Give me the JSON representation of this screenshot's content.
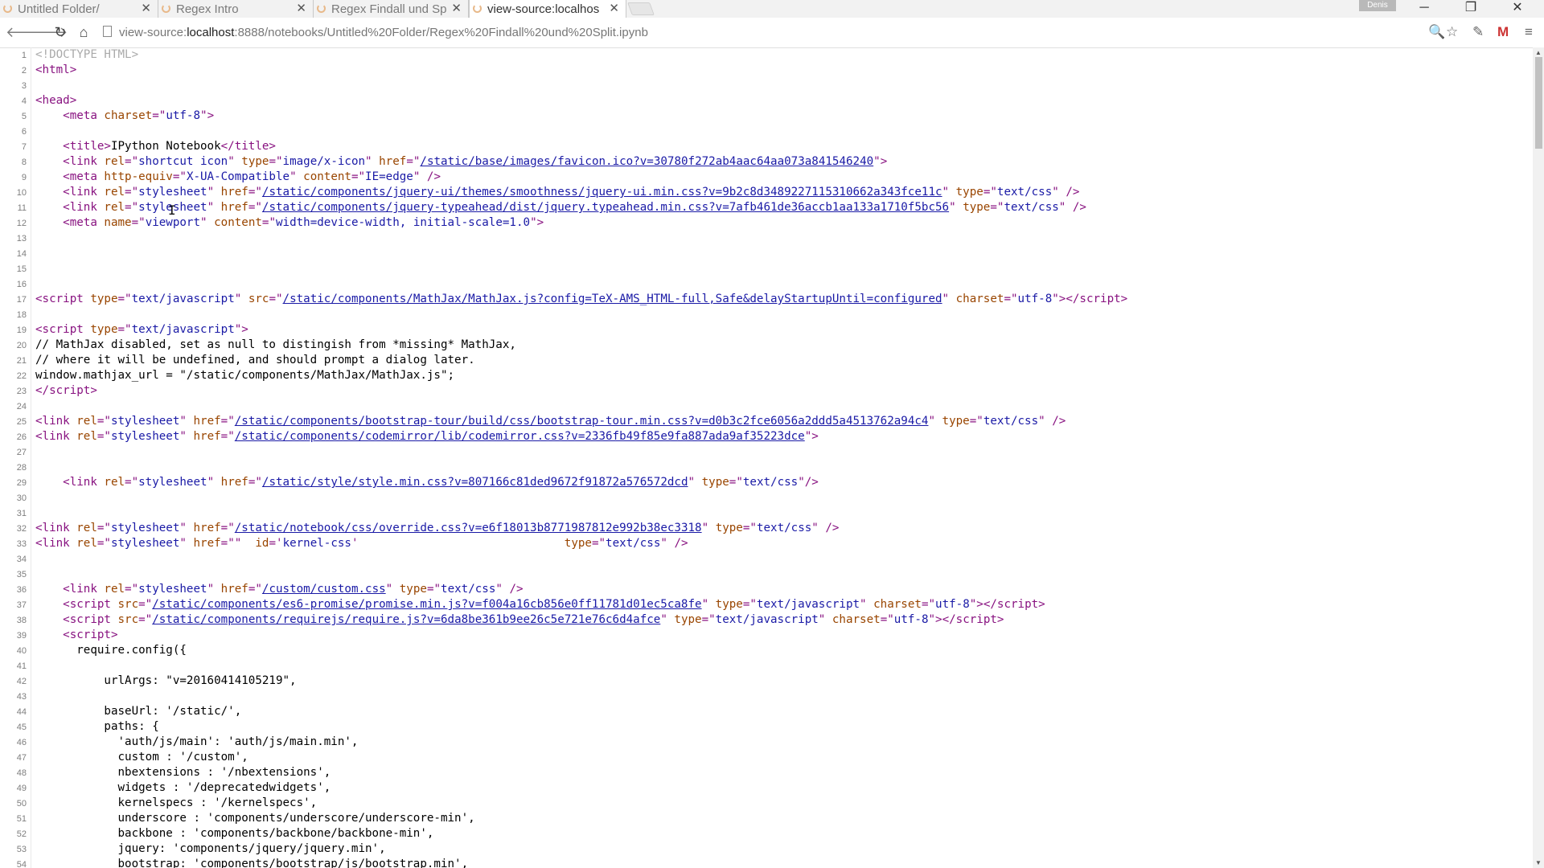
{
  "tabs": [
    {
      "label": "Untitled Folder/"
    },
    {
      "label": "Regex Intro"
    },
    {
      "label": "Regex Findall und Sp"
    },
    {
      "label": "view-source:localhos"
    }
  ],
  "profile_name": "Denis",
  "url_scheme": "view-source:",
  "url_host": "localhost",
  "url_rest": ":8888/notebooks/Untitled%20Folder/Regex%20Findall%20und%20Split.ipynb",
  "icons": [
    "back-icon",
    "forward-icon",
    "reload-icon",
    "home-icon",
    "page-icon",
    "zoom-icon",
    "star-icon",
    "extension-icon",
    "gmail-icon",
    "menu-icon"
  ],
  "colors": {
    "tag": "#881280",
    "attr": "#994500",
    "value": "#1a1aa6"
  },
  "source_lines": [
    {
      "n": "1",
      "html": "<span class=\"doctype\">&lt;!DOCTYPE HTML&gt;</span>"
    },
    {
      "n": "2",
      "html": "<span class=\"tag\">&lt;html&gt;</span>"
    },
    {
      "n": "3",
      "html": ""
    },
    {
      "n": "4",
      "html": "<span class=\"tag\">&lt;head&gt;</span>"
    },
    {
      "n": "5",
      "html": "    <span class=\"tag\">&lt;meta </span><span class=\"attr\">charset</span><span class=\"tag\">=\"</span><span class=\"val\">utf-8</span><span class=\"tag\">\"&gt;</span>"
    },
    {
      "n": "6",
      "html": ""
    },
    {
      "n": "7",
      "html": "    <span class=\"tag\">&lt;title&gt;</span>IPython Notebook<span class=\"tag\">&lt;/title&gt;</span>"
    },
    {
      "n": "8",
      "html": "    <span class=\"tag\">&lt;link </span><span class=\"attr\">rel</span><span class=\"tag\">=\"</span><span class=\"val\">shortcut icon</span><span class=\"tag\">\" </span><span class=\"attr\">type</span><span class=\"tag\">=\"</span><span class=\"val\">image/x-icon</span><span class=\"tag\">\" </span><span class=\"attr\">href</span><span class=\"tag\">=\"</span><span class=\"lnk\">/static/base/images/favicon.ico?v=30780f272ab4aac64aa073a841546240</span><span class=\"tag\">\"&gt;</span>"
    },
    {
      "n": "9",
      "html": "    <span class=\"tag\">&lt;meta </span><span class=\"attr\">http-equiv</span><span class=\"tag\">=\"</span><span class=\"val\">X-UA-Compatible</span><span class=\"tag\">\" </span><span class=\"attr\">content</span><span class=\"tag\">=\"</span><span class=\"val\">IE=edge</span><span class=\"tag\">\" /&gt;</span>"
    },
    {
      "n": "10",
      "html": "    <span class=\"tag\">&lt;link </span><span class=\"attr\">rel</span><span class=\"tag\">=\"</span><span class=\"val\">stylesheet</span><span class=\"tag\">\" </span><span class=\"attr\">href</span><span class=\"tag\">=\"</span><span class=\"lnk\">/static/components/jquery-ui/themes/smoothness/jquery-ui.min.css?v=9b2c8d3489227115310662a343fce11c</span><span class=\"tag\">\" </span><span class=\"attr\">type</span><span class=\"tag\">=\"</span><span class=\"val\">text/css</span><span class=\"tag\">\" /&gt;</span>"
    },
    {
      "n": "11",
      "html": "    <span class=\"tag\">&lt;link </span><span class=\"attr\">rel</span><span class=\"tag\">=\"</span><span class=\"val\">stylesheet</span><span class=\"tag\">\" </span><span class=\"attr\">href</span><span class=\"tag\">=\"</span><span class=\"lnk\">/static/components/jquery-typeahead/dist/jquery.typeahead.min.css?v=7afb461de36accb1aa133a1710f5bc56</span><span class=\"tag\">\" </span><span class=\"attr\">type</span><span class=\"tag\">=\"</span><span class=\"val\">text/css</span><span class=\"tag\">\" /&gt;</span>"
    },
    {
      "n": "12",
      "html": "    <span class=\"tag\">&lt;meta </span><span class=\"attr\">name</span><span class=\"tag\">=\"</span><span class=\"val\">viewport</span><span class=\"tag\">\" </span><span class=\"attr\">content</span><span class=\"tag\">=\"</span><span class=\"val\">width=device-width, initial-scale=1.0</span><span class=\"tag\">\"&gt;</span>"
    },
    {
      "n": "13",
      "html": ""
    },
    {
      "n": "14",
      "html": ""
    },
    {
      "n": "15",
      "html": ""
    },
    {
      "n": "16",
      "html": ""
    },
    {
      "n": "17",
      "html": "<span class=\"tag\">&lt;script </span><span class=\"attr\">type</span><span class=\"tag\">=\"</span><span class=\"val\">text/javascript</span><span class=\"tag\">\" </span><span class=\"attr\">src</span><span class=\"tag\">=\"</span><span class=\"lnk\">/static/components/MathJax/MathJax.js?config=TeX-AMS_HTML-full,Safe&amp;delayStartupUntil=configured</span><span class=\"tag\">\" </span><span class=\"attr\">charset</span><span class=\"tag\">=\"</span><span class=\"val\">utf-8</span><span class=\"tag\">\"&gt;&lt;/script&gt;</span>"
    },
    {
      "n": "18",
      "html": ""
    },
    {
      "n": "19",
      "html": "<span class=\"tag\">&lt;script </span><span class=\"attr\">type</span><span class=\"tag\">=\"</span><span class=\"val\">text/javascript</span><span class=\"tag\">\"&gt;</span>"
    },
    {
      "n": "20",
      "html": "// MathJax disabled, set as null to distingish from *missing* MathJax,"
    },
    {
      "n": "21",
      "html": "// where it will be undefined, and should prompt a dialog later."
    },
    {
      "n": "22",
      "html": "window.mathjax_url = \"/static/components/MathJax/MathJax.js\";"
    },
    {
      "n": "23",
      "html": "<span class=\"tag\">&lt;/script&gt;</span>"
    },
    {
      "n": "24",
      "html": ""
    },
    {
      "n": "25",
      "html": "<span class=\"tag\">&lt;link </span><span class=\"attr\">rel</span><span class=\"tag\">=\"</span><span class=\"val\">stylesheet</span><span class=\"tag\">\" </span><span class=\"attr\">href</span><span class=\"tag\">=\"</span><span class=\"lnk\">/static/components/bootstrap-tour/build/css/bootstrap-tour.min.css?v=d0b3c2fce6056a2ddd5a4513762a94c4</span><span class=\"tag\">\" </span><span class=\"attr\">type</span><span class=\"tag\">=\"</span><span class=\"val\">text/css</span><span class=\"tag\">\" /&gt;</span>"
    },
    {
      "n": "26",
      "html": "<span class=\"tag\">&lt;link </span><span class=\"attr\">rel</span><span class=\"tag\">=\"</span><span class=\"val\">stylesheet</span><span class=\"tag\">\" </span><span class=\"attr\">href</span><span class=\"tag\">=\"</span><span class=\"lnk\">/static/components/codemirror/lib/codemirror.css?v=2336fb49f85e9fa887ada9af35223dce</span><span class=\"tag\">\"&gt;</span>"
    },
    {
      "n": "27",
      "html": ""
    },
    {
      "n": "28",
      "html": ""
    },
    {
      "n": "29",
      "html": "    <span class=\"tag\">&lt;link </span><span class=\"attr\">rel</span><span class=\"tag\">=\"</span><span class=\"val\">stylesheet</span><span class=\"tag\">\" </span><span class=\"attr\">href</span><span class=\"tag\">=\"</span><span class=\"lnk\">/static/style/style.min.css?v=807166c81ded9672f91872a576572dcd</span><span class=\"tag\">\" </span><span class=\"attr\">type</span><span class=\"tag\">=\"</span><span class=\"val\">text/css</span><span class=\"tag\">\"/&gt;</span>"
    },
    {
      "n": "30",
      "html": ""
    },
    {
      "n": "31",
      "html": ""
    },
    {
      "n": "32",
      "html": "<span class=\"tag\">&lt;link </span><span class=\"attr\">rel</span><span class=\"tag\">=\"</span><span class=\"val\">stylesheet</span><span class=\"tag\">\" </span><span class=\"attr\">href</span><span class=\"tag\">=\"</span><span class=\"lnk\">/static/notebook/css/override.css?v=e6f18013b8771987812e992b38ec3318</span><span class=\"tag\">\" </span><span class=\"attr\">type</span><span class=\"tag\">=\"</span><span class=\"val\">text/css</span><span class=\"tag\">\" /&gt;</span>"
    },
    {
      "n": "33",
      "html": "<span class=\"tag\">&lt;link </span><span class=\"attr\">rel</span><span class=\"tag\">=\"</span><span class=\"val\">stylesheet</span><span class=\"tag\">\" </span><span class=\"attr\">href</span><span class=\"tag\">=\"\"  </span><span class=\"attr\">id</span><span class=\"tag\">='</span><span class=\"val\">kernel-css</span><span class=\"tag\">'                              </span><span class=\"attr\">type</span><span class=\"tag\">=\"</span><span class=\"val\">text/css</span><span class=\"tag\">\" /&gt;</span>"
    },
    {
      "n": "34",
      "html": ""
    },
    {
      "n": "35",
      "html": ""
    },
    {
      "n": "36",
      "html": "    <span class=\"tag\">&lt;link </span><span class=\"attr\">rel</span><span class=\"tag\">=\"</span><span class=\"val\">stylesheet</span><span class=\"tag\">\" </span><span class=\"attr\">href</span><span class=\"tag\">=\"</span><span class=\"lnk\">/custom/custom.css</span><span class=\"tag\">\" </span><span class=\"attr\">type</span><span class=\"tag\">=\"</span><span class=\"val\">text/css</span><span class=\"tag\">\" /&gt;</span>"
    },
    {
      "n": "37",
      "html": "    <span class=\"tag\">&lt;script </span><span class=\"attr\">src</span><span class=\"tag\">=\"</span><span class=\"lnk\">/static/components/es6-promise/promise.min.js?v=f004a16cb856e0ff11781d01ec5ca8fe</span><span class=\"tag\">\" </span><span class=\"attr\">type</span><span class=\"tag\">=\"</span><span class=\"val\">text/javascript</span><span class=\"tag\">\" </span><span class=\"attr\">charset</span><span class=\"tag\">=\"</span><span class=\"val\">utf-8</span><span class=\"tag\">\"&gt;&lt;/script&gt;</span>"
    },
    {
      "n": "38",
      "html": "    <span class=\"tag\">&lt;script </span><span class=\"attr\">src</span><span class=\"tag\">=\"</span><span class=\"lnk\">/static/components/requirejs/require.js?v=6da8be361b9ee26c5e721e76c6d4afce</span><span class=\"tag\">\" </span><span class=\"attr\">type</span><span class=\"tag\">=\"</span><span class=\"val\">text/javascript</span><span class=\"tag\">\" </span><span class=\"attr\">charset</span><span class=\"tag\">=\"</span><span class=\"val\">utf-8</span><span class=\"tag\">\"&gt;&lt;/script&gt;</span>"
    },
    {
      "n": "39",
      "html": "    <span class=\"tag\">&lt;script&gt;</span>"
    },
    {
      "n": "40",
      "html": "      require.config({"
    },
    {
      "n": "41",
      "html": ""
    },
    {
      "n": "42",
      "html": "          urlArgs: \"v=20160414105219\","
    },
    {
      "n": "43",
      "html": ""
    },
    {
      "n": "44",
      "html": "          baseUrl: '/static/',"
    },
    {
      "n": "45",
      "html": "          paths: {"
    },
    {
      "n": "46",
      "html": "            'auth/js/main': 'auth/js/main.min',"
    },
    {
      "n": "47",
      "html": "            custom : '/custom',"
    },
    {
      "n": "48",
      "html": "            nbextensions : '/nbextensions',"
    },
    {
      "n": "49",
      "html": "            widgets : '/deprecatedwidgets',"
    },
    {
      "n": "50",
      "html": "            kernelspecs : '/kernelspecs',"
    },
    {
      "n": "51",
      "html": "            underscore : 'components/underscore/underscore-min',"
    },
    {
      "n": "52",
      "html": "            backbone : 'components/backbone/backbone-min',"
    },
    {
      "n": "53",
      "html": "            jquery: 'components/jquery/jquery.min',"
    },
    {
      "n": "54",
      "html": "            bootstrap: 'components/bootstrap/js/bootstrap.min',"
    }
  ]
}
